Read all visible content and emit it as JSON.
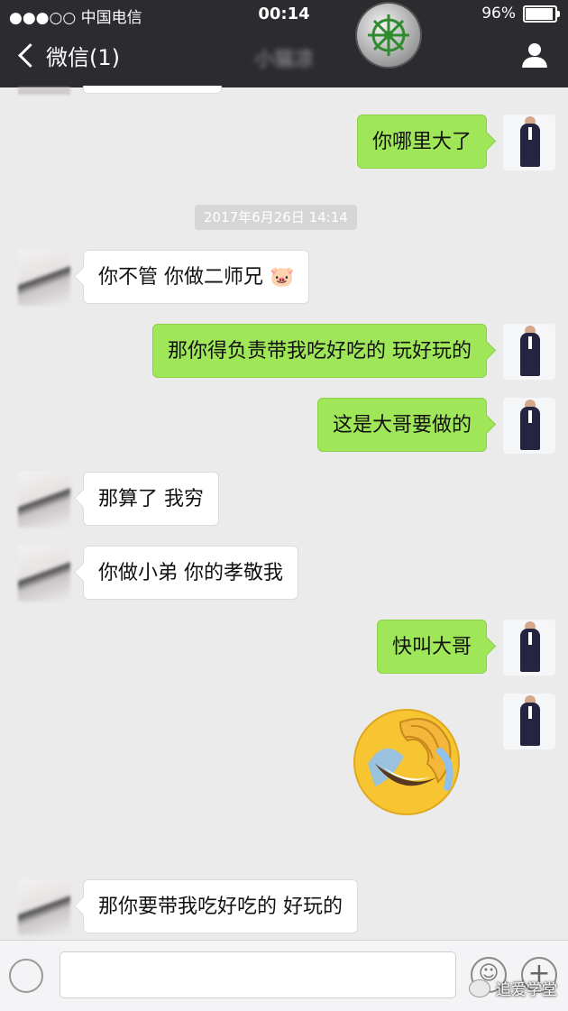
{
  "status": {
    "carrier": "●●●○○ 中国电信",
    "time": "00:14",
    "battery": "96%"
  },
  "nav": {
    "back_label": "微信(1)",
    "title": "小猫凉"
  },
  "timestamp": "2017年6月26日 14:14",
  "messages": [
    {
      "from": "me",
      "text": "你哪里大了"
    },
    {
      "from": "her",
      "text": "你不管 你做二师兄"
    },
    {
      "from": "me",
      "text": "那你得负责带我吃好吃的 玩好玩的"
    },
    {
      "from": "me",
      "text": "这是大哥要做的"
    },
    {
      "from": "her",
      "text": "那算了 我穷"
    },
    {
      "from": "her",
      "text": "你做小弟 你的孝敬我"
    },
    {
      "from": "me",
      "text": "快叫大哥"
    },
    {
      "from": "me",
      "text": ""
    },
    {
      "from": "her",
      "text": "那你要带我吃好吃的 好玩的"
    }
  ],
  "pig_emoji": "🐷",
  "icons": {
    "back": "chevron-left-icon",
    "user": "user-icon",
    "voice": "voice-icon",
    "emoji": "smiley-icon",
    "plus": "plus-icon",
    "sticker": "facepalm-laugh-emoji-icon"
  },
  "watermark": "追爱学堂",
  "colors": {
    "nav_bg": "#2c2c30",
    "chat_bg": "#ebebeb",
    "my_bubble": "#9fe658",
    "her_bubble": "#ffffff"
  }
}
